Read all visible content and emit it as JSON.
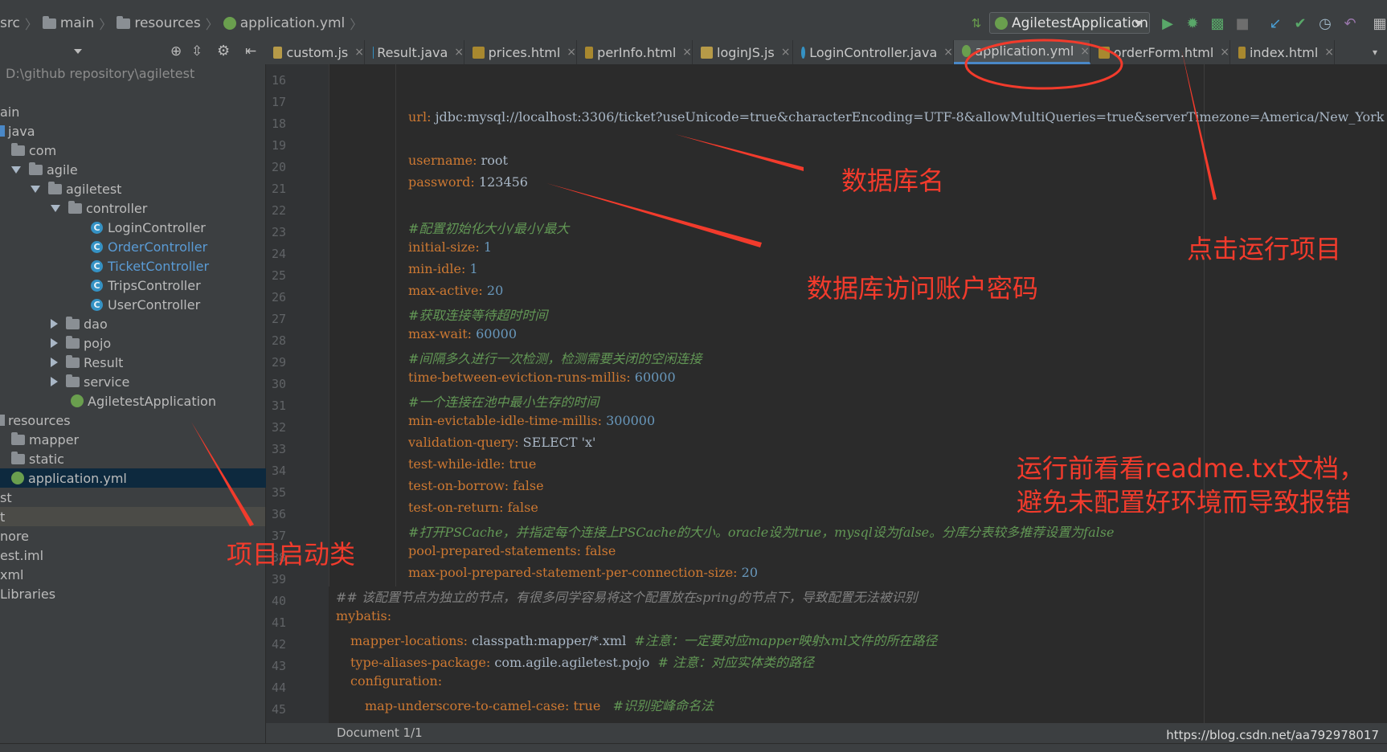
{
  "breadcrumb": [
    "src",
    "main",
    "resources",
    "application.yml"
  ],
  "run_config": "AgiletestApplication",
  "project_path": "D:\\github repository\\agiletest",
  "tabs": [
    {
      "label": "custom.js",
      "icon_color": "#b69a48"
    },
    {
      "label": "Result.java",
      "icon_color": "#3592c4"
    },
    {
      "label": "prices.html",
      "icon_color": "#a8882f"
    },
    {
      "label": "perInfo.html",
      "icon_color": "#a8882f"
    },
    {
      "label": "loginJS.js",
      "icon_color": "#b69a48"
    },
    {
      "label": "LoginController.java",
      "icon_color": "#3592c4"
    },
    {
      "label": "application.yml",
      "icon_color": "#6a9f4e"
    },
    {
      "label": "orderForm.html",
      "icon_color": "#a8882f"
    },
    {
      "label": "index.html",
      "icon_color": "#a8882f"
    }
  ],
  "tree": [
    {
      "label": "ain"
    },
    {
      "label": "java"
    },
    {
      "label": "com"
    },
    {
      "label": "agile"
    },
    {
      "label": "agiletest"
    },
    {
      "label": "controller"
    },
    {
      "label": "LoginController"
    },
    {
      "label": "OrderController"
    },
    {
      "label": "TicketController"
    },
    {
      "label": "TripsController"
    },
    {
      "label": "UserController"
    },
    {
      "label": "dao"
    },
    {
      "label": "pojo"
    },
    {
      "label": "Result"
    },
    {
      "label": "service"
    },
    {
      "label": "AgiletestApplication"
    },
    {
      "label": "resources"
    },
    {
      "label": "mapper"
    },
    {
      "label": "static"
    },
    {
      "label": "application.yml"
    },
    {
      "label": "st"
    },
    {
      "label": "t"
    },
    {
      "label": "nore"
    },
    {
      "label": "est.iml"
    },
    {
      "label": "xml"
    },
    {
      "label": "Libraries"
    }
  ],
  "code": {
    "line_numbers": [
      "16",
      "17",
      "18",
      "19",
      "20",
      "21",
      "22",
      "23",
      "24",
      "25",
      "26",
      "27",
      "28",
      "29",
      "30",
      "31",
      "32",
      "33",
      "34",
      "35",
      "36",
      "37",
      "38",
      "39",
      "40",
      "41",
      "42",
      "43",
      "44",
      "45"
    ],
    "url_key": "url:",
    "url_value": "jdbc:mysql://localhost:3306/ticket?useUnicode=true&characterEncoding=UTF-8&allowMultiQueries=true&serverTimezone=America/New_York",
    "username_key": "username:",
    "username_value": "root",
    "password_key": "password:",
    "password_value": "123456",
    "comment_pool": "#配置初始化大小/最小/最大",
    "initial_size_key": "initial-size:",
    "initial_size_value": "1",
    "min_idle_key": "min-idle:",
    "min_idle_value": "1",
    "max_active_key": "max-active:",
    "max_active_value": "20",
    "comment_wait": "#获取连接等待超时时间",
    "max_wait_key": "max-wait:",
    "max_wait_value": "60000",
    "comment_eviction": "#间隔多久进行一次检测，检测需要关闭的空闲连接",
    "eviction_key": "time-between-eviction-runs-millis:",
    "eviction_value": "60000",
    "comment_min_life": "#一个连接在池中最小生存的时间",
    "min_evictable_key": "min-evictable-idle-time-millis:",
    "min_evictable_value": "300000",
    "validation_key": "validation-query:",
    "validation_value": "SELECT 'x'",
    "test_idle_key": "test-while-idle:",
    "test_idle_value": "true",
    "test_borrow_key": "test-on-borrow:",
    "test_borrow_value": "false",
    "test_return_key": "test-on-return:",
    "test_return_value": "false",
    "comment_pscache": "#打开PSCache，并指定每个连接上PSCache的大小。oracle设为true，mysql设为false。分库分表较多推荐设置为false",
    "pool_prepared_key": "pool-prepared-statements:",
    "pool_prepared_value": "false",
    "max_pool_key": "max-pool-prepared-statement-per-connection-size:",
    "max_pool_value": "20",
    "comment_mybatis_note": "## 该配置节点为独立的节点，有很多同学容易将这个配置放在spring的节点下，导致配置无法被识别",
    "mybatis_key": "mybatis:",
    "mapper_locations_key": "mapper-locations:",
    "mapper_locations_value": "classpath:mapper/*.xml",
    "mapper_locations_comment": "#注意：一定要对应mapper映射xml文件的所在路径",
    "type_aliases_key": "type-aliases-package:",
    "type_aliases_value": "com.agile.agiletest.pojo",
    "type_aliases_comment": "# 注意：对应实体类的路径",
    "configuration_key": "configuration:",
    "camel_key": "map-underscore-to-camel-case:",
    "camel_value": "true",
    "camel_comment": "#识别驼峰命名法"
  },
  "status": {
    "document": "Document 1/1",
    "watermark": "https://blog.csdn.net/aa792978017"
  },
  "annotations": {
    "db_name": "数据库名",
    "db_account": "数据库访问账户密码",
    "run_project": "点击运行项目",
    "startup_class": "项目启动类",
    "readme_line1": "运行前看看readme.txt文档，",
    "readme_line2": "避免未配置好环境而导致报错"
  },
  "colors": {
    "annotation_red": "#f23b2c",
    "keyword": "#cc7832",
    "comment": "#629755",
    "number": "#6897bb",
    "selection": "#0d293e"
  }
}
